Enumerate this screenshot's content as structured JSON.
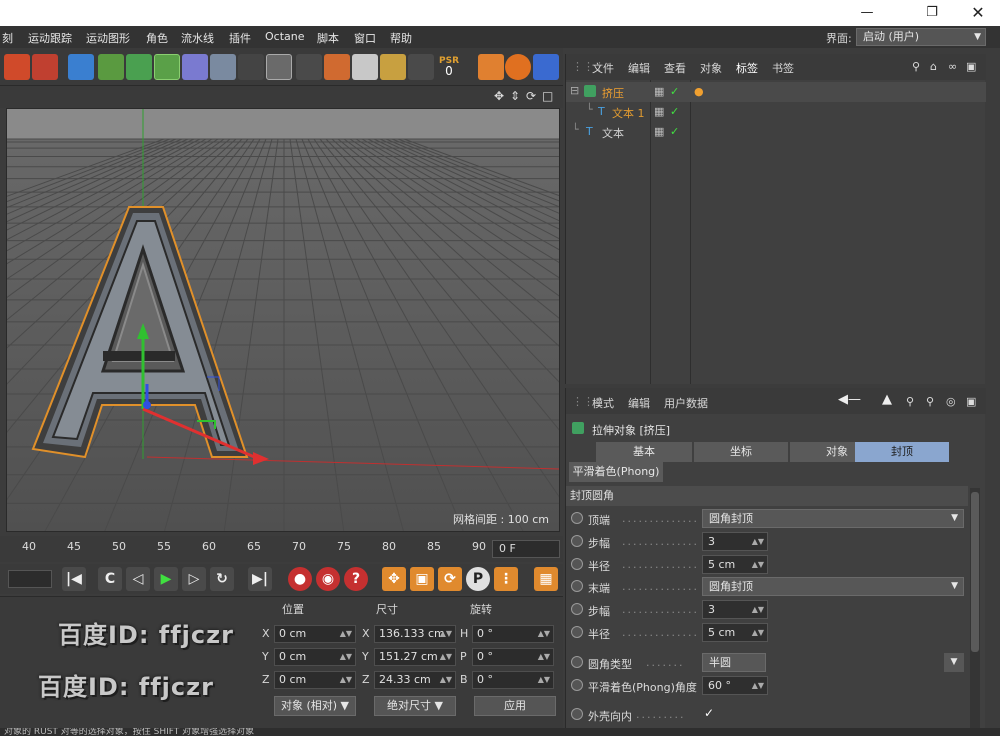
{
  "menu": {
    "items": [
      "刻",
      "运动跟踪",
      "运动图形",
      "角色",
      "流水线",
      "插件",
      "Octane",
      "脚本",
      "窗口",
      "帮助"
    ],
    "layout_label": "界面:",
    "layout_value": "启动 (用户)"
  },
  "toolbar": {
    "psr_label": "PSR",
    "psr_value": "0"
  },
  "viewport": {
    "grid_spacing": "网格间距 : 100 cm"
  },
  "timeline": {
    "ticks": [
      "40",
      "45",
      "50",
      "55",
      "60",
      "65",
      "70",
      "75",
      "80",
      "85",
      "90"
    ],
    "current_frame": "0 F"
  },
  "coordinates": {
    "headers": {
      "position": "位置",
      "size": "尺寸",
      "rotation": "旋转"
    },
    "position": [
      {
        "axis": "X",
        "value": "0 cm"
      },
      {
        "axis": "Y",
        "value": "0 cm"
      },
      {
        "axis": "Z",
        "value": "0 cm"
      }
    ],
    "size": [
      {
        "axis": "X",
        "value": "136.133 cm"
      },
      {
        "axis": "Y",
        "value": "151.27 cm"
      },
      {
        "axis": "Z",
        "value": "24.33 cm"
      }
    ],
    "rotation": [
      {
        "axis": "H",
        "value": "0 °"
      },
      {
        "axis": "P",
        "value": "0 °"
      },
      {
        "axis": "B",
        "value": "0 °"
      }
    ],
    "mode_select": "对象 (相对)",
    "size_select": "绝对尺寸",
    "apply_button": "应用"
  },
  "watermarks": [
    "百度ID: ffjczr",
    "百度ID: ffjczr"
  ],
  "status_text": "对象的 RUST 对等的选择对象，按住 SHIFT 对象增强选择对象",
  "object_manager": {
    "menu": [
      "文件",
      "编辑",
      "查看",
      "对象",
      "标签",
      "书签"
    ],
    "objects": [
      {
        "name": "挤压",
        "color": "#f0a030"
      },
      {
        "name": "文本 1",
        "color": "#e09a30"
      },
      {
        "name": "文本",
        "color": "#d0d0d0"
      }
    ]
  },
  "attribute_manager": {
    "menu": [
      "模式",
      "编辑",
      "用户数据"
    ],
    "object_title": "拉伸对象 [挤压]",
    "tabs": [
      "基本",
      "坐标",
      "对象",
      "封顶"
    ],
    "active_tab": "封顶",
    "phong_tab": "平滑着色(Phong)",
    "section_title": "封顶圆角",
    "properties": [
      {
        "label": "顶端",
        "type": "dropdown",
        "value": "圆角封顶"
      },
      {
        "label": "步幅",
        "type": "number",
        "value": "3"
      },
      {
        "label": "半径",
        "type": "number",
        "value": "5 cm"
      },
      {
        "label": "末端",
        "type": "dropdown",
        "value": "圆角封顶"
      },
      {
        "label": "步幅",
        "type": "number",
        "value": "3"
      },
      {
        "label": "半径",
        "type": "number",
        "value": "5 cm"
      },
      {
        "label": "圆角类型",
        "type": "dropdown",
        "value": "半圆"
      },
      {
        "label": "平滑着色(Phong)角度",
        "type": "number",
        "value": "60 °"
      },
      {
        "label": "外壳向内",
        "type": "check",
        "value": "✓"
      }
    ]
  },
  "colors": {
    "accent_tab": "#8aa6cf",
    "selected_object": "#f0a030",
    "x_axis": "#e03030",
    "y_axis": "#30c030",
    "z_axis": "#3050e0"
  }
}
